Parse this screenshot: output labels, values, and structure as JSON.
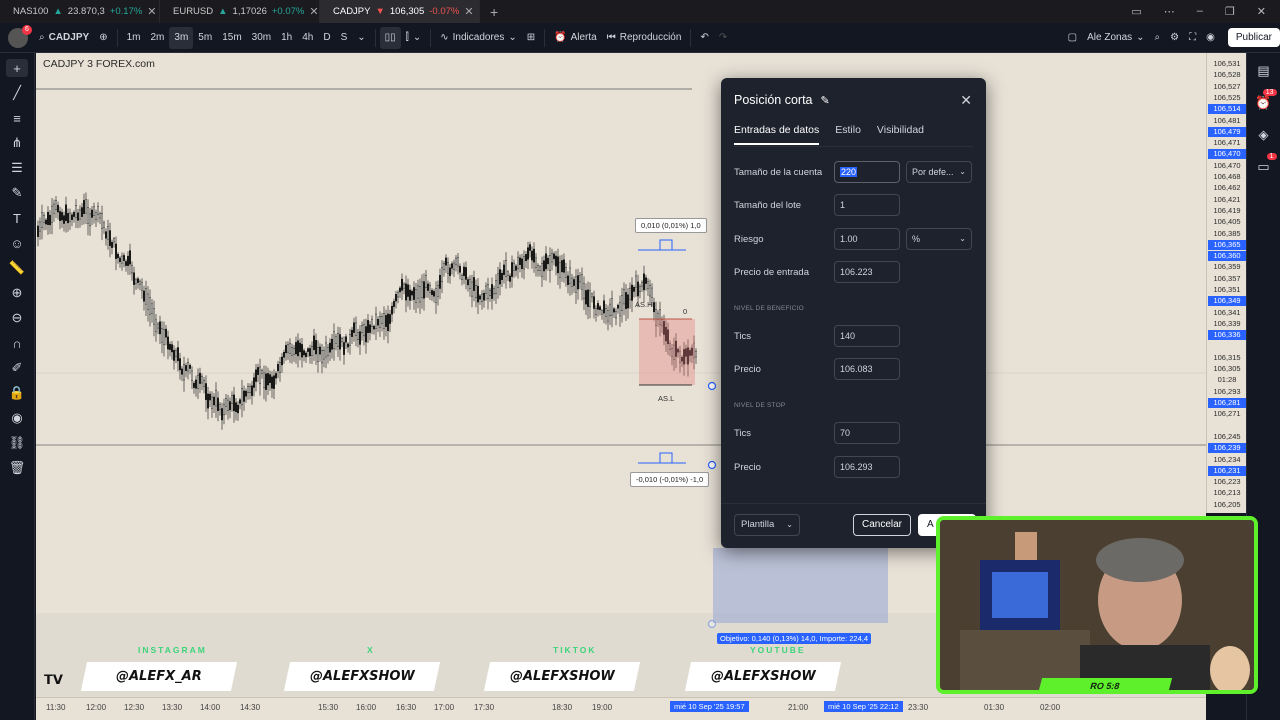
{
  "browser_tabs": [
    {
      "symbol": "NAS100",
      "price": "23.870,3",
      "change": "+0.17%",
      "dir": "up"
    },
    {
      "symbol": "EURUSD",
      "price": "1,17026",
      "change": "+0.07%",
      "dir": "up"
    },
    {
      "symbol": "CADJPY",
      "price": "106,305",
      "change": "-0.07%",
      "dir": "down"
    }
  ],
  "toolbar": {
    "symbol": "CADJPY",
    "intervals": [
      "1m",
      "2m",
      "3m",
      "5m",
      "15m",
      "30m",
      "1h",
      "4h",
      "D",
      "S"
    ],
    "active_interval": "3m",
    "indicators": "Indicadores",
    "alert": "Alerta",
    "replay": "Reproducción",
    "layout_name": "Ale Zonas",
    "publish": "Publicar",
    "avatar_badge": "6"
  },
  "chart": {
    "title": "CADJPY  3  FOREX.com",
    "tip_top": "0,010 (0,01%) 1,0",
    "tip_bottom": "-0,010 (-0,01%) -1,0",
    "label_ash": "AS.H",
    "label_asl": "AS.L",
    "label_zero": "0",
    "objective": "Objetivo: 0,140 (0,13%) 14,0, Importe: 224,4"
  },
  "price_axis": [
    {
      "v": "106,531",
      "hl": false
    },
    {
      "v": "106,528",
      "hl": false
    },
    {
      "v": "106,527",
      "hl": false
    },
    {
      "v": "106,525",
      "hl": false
    },
    {
      "v": "106,514",
      "hl": true
    },
    {
      "v": "106,481",
      "hl": false
    },
    {
      "v": "106,479",
      "hl": true
    },
    {
      "v": "106,471",
      "hl": false
    },
    {
      "v": "106,470",
      "hl": true
    },
    {
      "v": "106,470",
      "hl": false
    },
    {
      "v": "106,468",
      "hl": false
    },
    {
      "v": "106,462",
      "hl": false
    },
    {
      "v": "106,421",
      "hl": false
    },
    {
      "v": "106,419",
      "hl": false
    },
    {
      "v": "106,405",
      "hl": false
    },
    {
      "v": "106,385",
      "hl": false
    },
    {
      "v": "106,365",
      "hl": true
    },
    {
      "v": "106,360",
      "hl": true
    },
    {
      "v": "106,359",
      "hl": false
    },
    {
      "v": "106,357",
      "hl": false
    },
    {
      "v": "106,351",
      "hl": false
    },
    {
      "v": "106,349",
      "hl": true
    },
    {
      "v": "106,341",
      "hl": false
    },
    {
      "v": "106,339",
      "hl": false
    },
    {
      "v": "106,336",
      "hl": true
    },
    {
      "v": "",
      "hl": false
    },
    {
      "v": "106,315",
      "hl": false
    },
    {
      "v": "106,305",
      "hl": false
    },
    {
      "v": "01:28",
      "hl": false
    },
    {
      "v": "106,293",
      "hl": false
    },
    {
      "v": "106,281",
      "hl": true
    },
    {
      "v": "106,271",
      "hl": false
    },
    {
      "v": "",
      "hl": false
    },
    {
      "v": "106,245",
      "hl": false
    },
    {
      "v": "106,239",
      "hl": true
    },
    {
      "v": "106,234",
      "hl": false
    },
    {
      "v": "106,231",
      "hl": true
    },
    {
      "v": "106,223",
      "hl": false
    },
    {
      "v": "106,213",
      "hl": false
    },
    {
      "v": "106,205",
      "hl": false
    }
  ],
  "dialog": {
    "title": "Posición corta",
    "tabs": [
      "Entradas de datos",
      "Estilo",
      "Visibilidad"
    ],
    "account_size_label": "Tamaño de la cuenta",
    "account_size": "220",
    "account_currency": "Por defe...",
    "lot_size_label": "Tamaño del lote",
    "lot_size": "1",
    "risk_label": "Riesgo",
    "risk": "1.00",
    "risk_unit": "%",
    "entry_label": "Precio de entrada",
    "entry": "106.223",
    "profit_section": "NIVEL DE BENEFICIO",
    "profit_ticks_label": "Tics",
    "profit_ticks": "140",
    "profit_price_label": "Precio",
    "profit_price": "106.083",
    "stop_section": "NIVEL DE STOP",
    "stop_ticks_label": "Tics",
    "stop_ticks": "70",
    "stop_price_label": "Precio",
    "stop_price": "106.293",
    "template": "Plantilla",
    "cancel": "Cancelar",
    "accept": "A"
  },
  "social": {
    "labels": [
      "INSTAGRAM",
      "X",
      "TIKTOK",
      "YOUTUBE"
    ],
    "handles": [
      "@ALEFX_AR",
      "@ALEFXSHOW",
      "@ALEFXSHOW",
      "@ALEFXSHOW"
    ]
  },
  "time_axis": [
    "11:30",
    "12:00",
    "12:30",
    "13:30",
    "14:00",
    "14:30",
    "15:30",
    "16:00",
    "16:30",
    "17:00",
    "17:30",
    "18:30",
    "19:00",
    "21:00",
    "23:30",
    "01:30",
    "02:00"
  ],
  "time_hl": [
    "mié 10 Sep '25  19:57",
    "mié 10 Sep '25  22:12"
  ],
  "webcam_label": "RO 5:8",
  "right_badges": {
    "notifications": "13",
    "chat": "1"
  }
}
